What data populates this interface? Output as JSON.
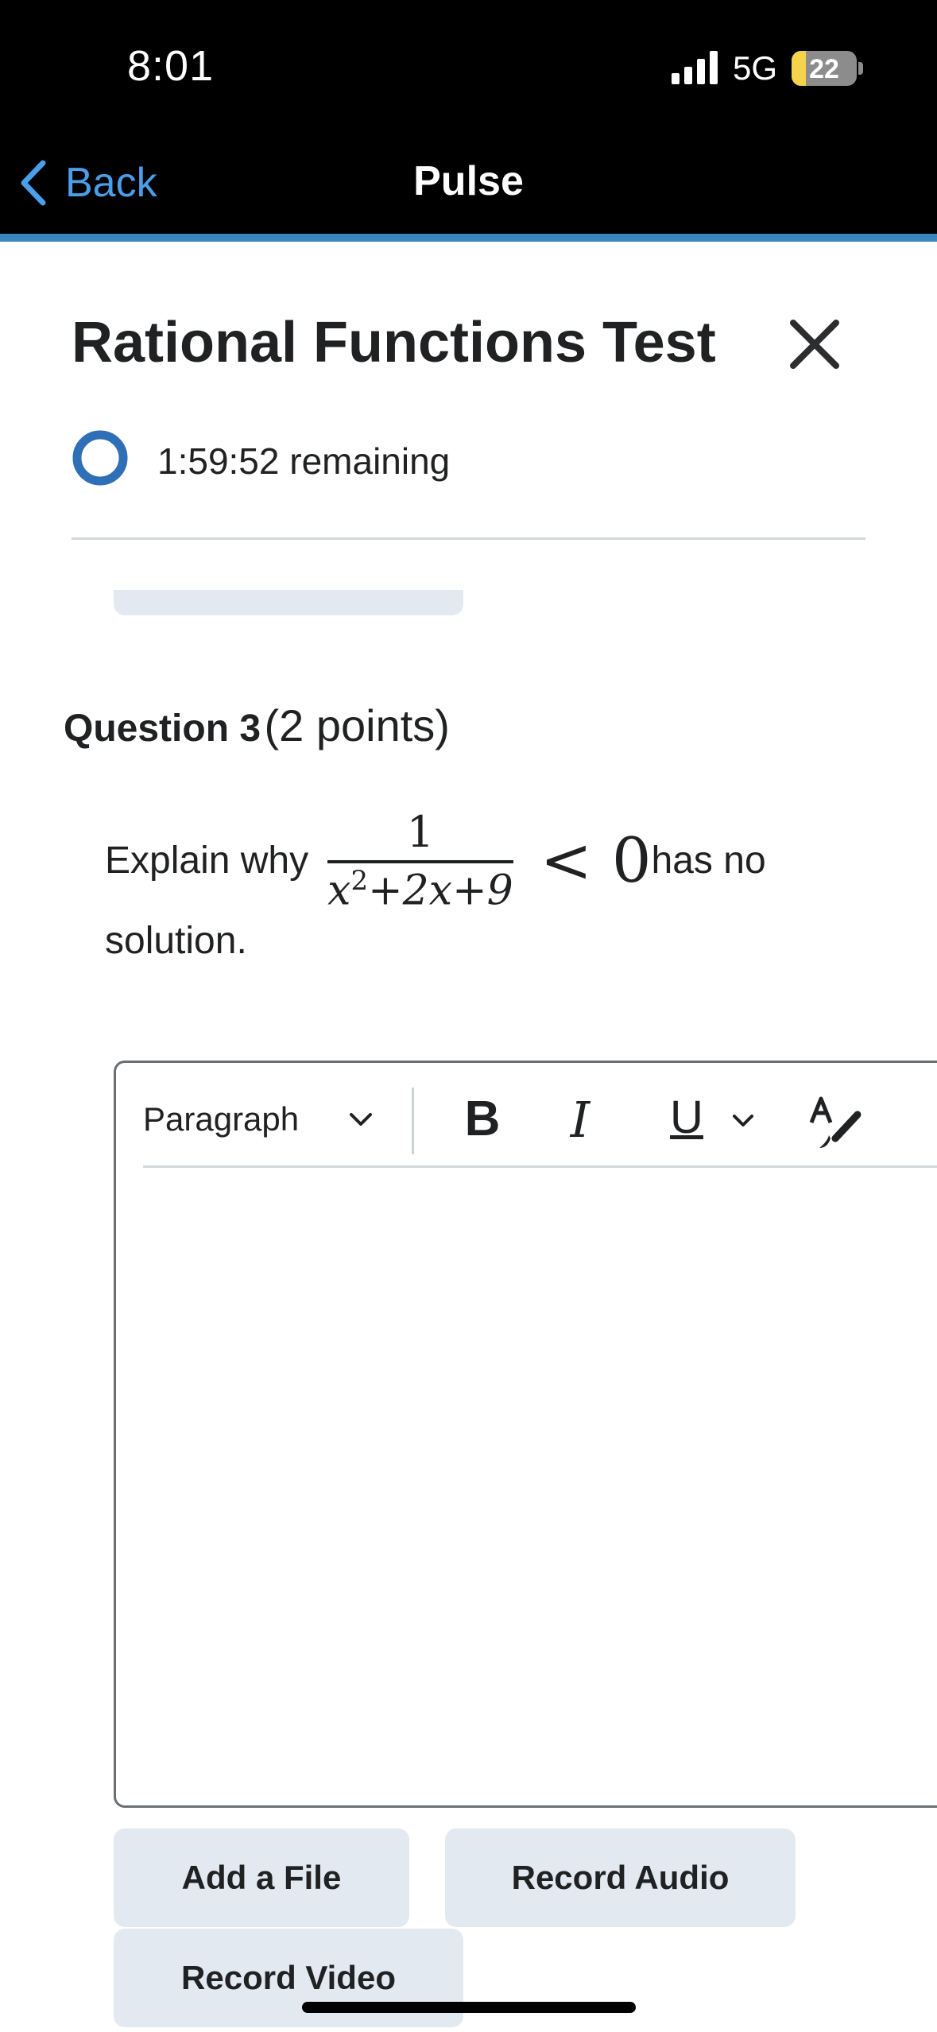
{
  "status_bar": {
    "time": "8:01",
    "network": "5G",
    "battery_level": "22",
    "battery_fraction": 0.22
  },
  "nav": {
    "back_label": "Back",
    "title": "Pulse"
  },
  "colors": {
    "accent_line": "#3a87c0",
    "link_blue": "#4a9eea",
    "timer_ring": "#2f6fb5",
    "button_bg": "#e3e9f1"
  },
  "quiz": {
    "title": "Rational Functions Test",
    "time_remaining": "1:59:52",
    "remaining_label": "remaining"
  },
  "question": {
    "label": "Question 3",
    "points": "(2 points)",
    "prefix": "Explain why",
    "fraction_numerator": "1",
    "fraction_denominator_x": "x",
    "fraction_denominator_exp": "2",
    "fraction_denominator_rest": "+2x+9",
    "inequality": "< 0",
    "suffix": "has no",
    "line2": "solution."
  },
  "editor": {
    "paragraph_label": "Paragraph",
    "bold": "B",
    "italic": "I",
    "underline": "U",
    "content": ""
  },
  "buttons": {
    "add_file": "Add a File",
    "record_audio": "Record Audio",
    "record_video": "Record Video"
  },
  "icons": [
    "chevron-left-icon",
    "close-icon",
    "timer-ring-icon",
    "chevron-down-icon",
    "format-brush-icon",
    "signal-icon",
    "battery-icon"
  ]
}
